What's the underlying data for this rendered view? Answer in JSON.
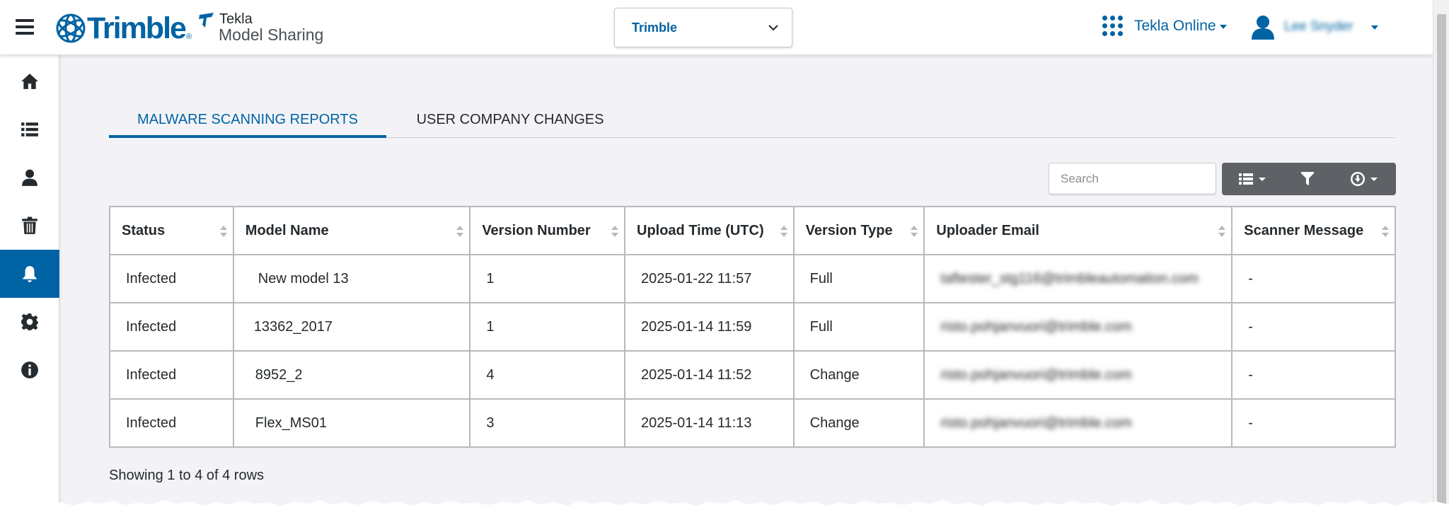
{
  "header": {
    "brand": "Trimble",
    "brand_mark": "®",
    "product_brand": "Tekla",
    "product_name": "Model Sharing",
    "org_select": {
      "value": "Trimble"
    },
    "apps_label": "Tekla Online",
    "user_name": "Lee Snyder"
  },
  "sidebar": {
    "items": [
      {
        "icon": "home-icon"
      },
      {
        "icon": "list-icon"
      },
      {
        "icon": "user-icon"
      },
      {
        "icon": "trash-icon"
      },
      {
        "icon": "bell-icon",
        "active": true
      },
      {
        "icon": "gear-icon"
      },
      {
        "icon": "info-icon"
      }
    ]
  },
  "tabs": [
    {
      "label": "MALWARE SCANNING REPORTS",
      "active": true
    },
    {
      "label": "USER COMPANY CHANGES",
      "active": false
    }
  ],
  "search": {
    "placeholder": "Search",
    "value": ""
  },
  "table": {
    "columns": [
      "Status",
      "Model Name",
      "Version Number",
      "Upload Time (UTC)",
      "Version Type",
      "Uploader Email",
      "Scanner Message"
    ],
    "rows": [
      [
        "Infected",
        "New model 13",
        "1",
        "2025-01-22 11:57",
        "Full",
        "taftester_stg116@trimbleautomation.com",
        "-"
      ],
      [
        "Infected",
        "13362_2017",
        "1",
        "2025-01-14 11:59",
        "Full",
        "risto.pohjanvuori@trimble.com",
        "-"
      ],
      [
        "Infected",
        "8952_2",
        "4",
        "2025-01-14 11:52",
        "Change",
        "risto.pohjanvuori@trimble.com",
        "-"
      ],
      [
        "Infected",
        "Flex_MS01",
        "3",
        "2025-01-14 11:13",
        "Change",
        "risto.pohjanvuori@trimble.com",
        "-"
      ]
    ]
  },
  "footer": {
    "text": "Showing 1 to 4 of 4 rows"
  },
  "colors": {
    "brand": "#0063a3",
    "toolbar": "#5e6165",
    "background": "#f3f3f7"
  }
}
